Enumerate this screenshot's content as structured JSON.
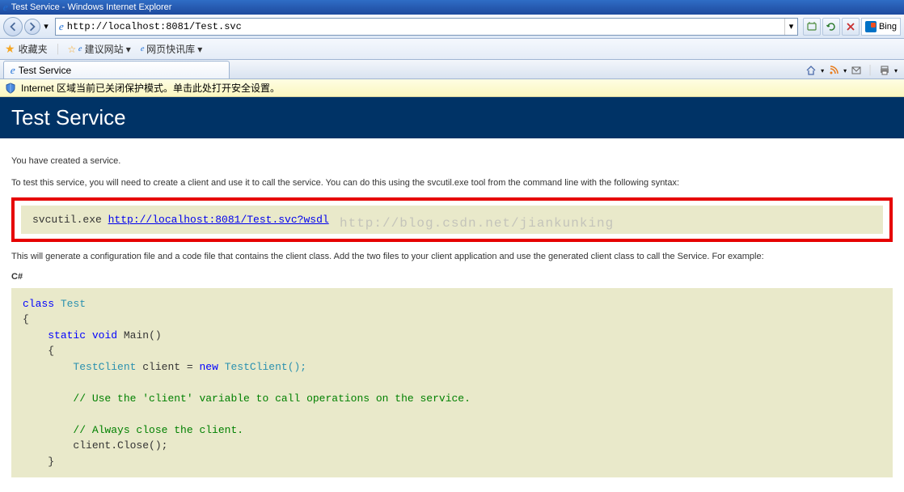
{
  "window": {
    "title": "Test Service - Windows Internet Explorer"
  },
  "addressBar": {
    "url": "http://localhost:8081/Test.svc",
    "searchEngine": "Bing"
  },
  "favoritesBar": {
    "label": "收藏夹",
    "items": [
      {
        "label": "建议网站",
        "hasDropdown": true
      },
      {
        "label": "网页快讯库",
        "hasDropdown": true
      }
    ]
  },
  "tab": {
    "title": "Test Service"
  },
  "infoBar": {
    "text": "Internet 区域当前已关闭保护模式。单击此处打开安全设置。"
  },
  "page": {
    "heading": "Test Service",
    "intro": "You have created a service.",
    "testInstructions": "To test this service, you will need to create a client and use it to call the service. You can do this using the svcutil.exe tool from the command line with the following syntax:",
    "svcCmd": "svcutil.exe ",
    "svcLink": "http://localhost:8081/Test.svc?wsdl",
    "afterCmd": "This will generate a configuration file and a code file that contains the client class. Add the two files to your client application and use the generated client class to call the Service. For example:",
    "langLabel": "C#",
    "code": {
      "kw_class": "class",
      "name_Test": "Test",
      "kw_static": "static",
      "kw_void": "void",
      "name_Main": "Main()",
      "cls_TestClient": "TestClient",
      "name_client": "client = ",
      "kw_new": "new",
      "ctor": "TestClient();",
      "comment1": "// Use the 'client' variable to call operations on the service.",
      "comment2": "// Always close the client.",
      "close": "client.Close();"
    }
  },
  "watermark": "http://blog.csdn.net/jiankunking"
}
